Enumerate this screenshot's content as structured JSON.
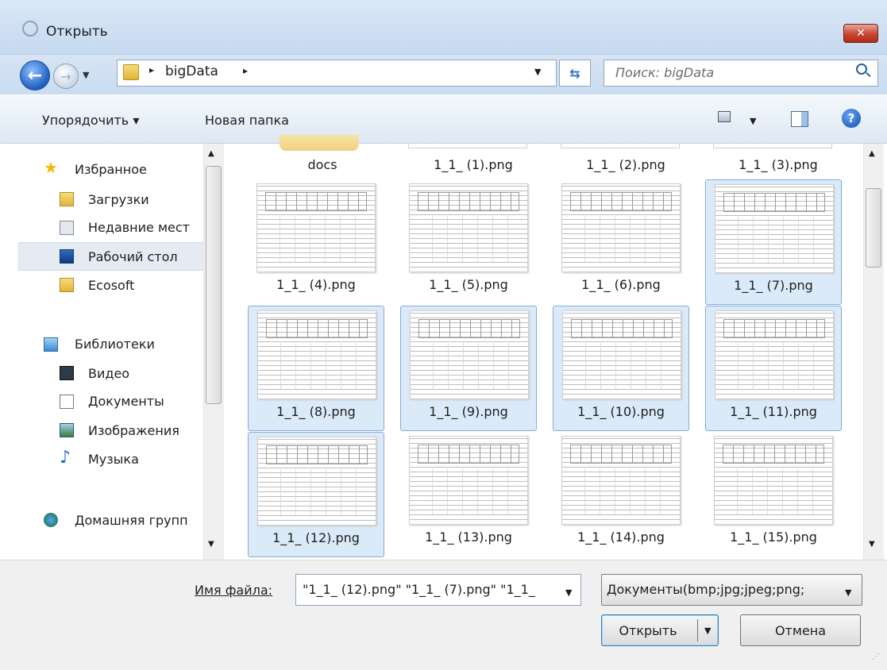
{
  "window": {
    "title": "Открыть",
    "close_glyph": "✕"
  },
  "address": {
    "path_root": "bigData",
    "sep": "▸"
  },
  "search": {
    "placeholder": "Поиск: bigData"
  },
  "toolbar": {
    "organize": "Упорядочить ▾",
    "new_folder": "Новая папка",
    "help": "?"
  },
  "nav": {
    "favorites": "Избранное",
    "downloads": "Загрузки",
    "recent": "Недавние мест",
    "desktop": "Рабочий стол",
    "ecosoft": "Ecosoft",
    "libraries": "Библиотеки",
    "video": "Видео",
    "documents": "Документы",
    "images": "Изображения",
    "music": "Музыка",
    "homegroup": "Домашняя групп"
  },
  "files": {
    "top_row": [
      "docs",
      "1_1_ (1).png",
      "1_1_ (2).png",
      "1_1_ (3).png"
    ],
    "items": [
      {
        "label": "1_1_ (4).png",
        "selected": false
      },
      {
        "label": "1_1_ (5).png",
        "selected": false
      },
      {
        "label": "1_1_ (6).png",
        "selected": false
      },
      {
        "label": "1_1_ (7).png",
        "selected": true
      },
      {
        "label": "1_1_ (8).png",
        "selected": true
      },
      {
        "label": "1_1_ (9).png",
        "selected": true
      },
      {
        "label": "1_1_ (10).png",
        "selected": true
      },
      {
        "label": "1_1_ (11).png",
        "selected": true
      },
      {
        "label": "1_1_ (12).png",
        "selected": true
      },
      {
        "label": "1_1_ (13).png",
        "selected": false
      },
      {
        "label": "1_1_ (14).png",
        "selected": false
      },
      {
        "label": "1_1_ (15).png",
        "selected": false
      }
    ]
  },
  "bottom": {
    "filename_label": "Имя файла:",
    "filename_value": "\"1_1_ (12).png\" \"1_1_ (7).png\" \"1_1_",
    "filetype_value": "Документы(bmp;jpg;jpeg;png;",
    "open_label": "Открыть",
    "cancel_label": "Отмена"
  },
  "colors": {
    "accent": "#1d5fc2",
    "selection": "#dbeaf8",
    "selection_border": "#84acdd"
  }
}
